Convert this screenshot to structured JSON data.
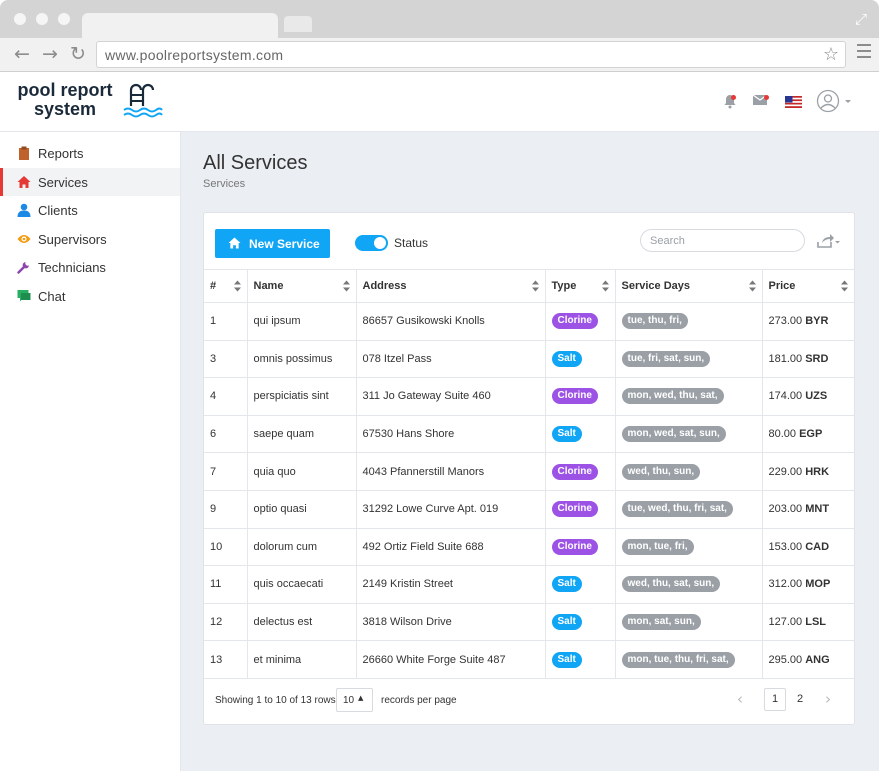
{
  "browser": {
    "url": "www.poolreportsystem.com"
  },
  "app": {
    "logo_line1": "pool report",
    "logo_line2": "system"
  },
  "sidebar": {
    "items": [
      {
        "label": "Reports",
        "icon": "clipboard-icon",
        "color": "#c0622b"
      },
      {
        "label": "Services",
        "icon": "home-icon",
        "color": "#e53935",
        "active": true
      },
      {
        "label": "Clients",
        "icon": "user-icon",
        "color": "#1e88e5"
      },
      {
        "label": "Supervisors",
        "icon": "eye-icon",
        "color": "#f39c12"
      },
      {
        "label": "Technicians",
        "icon": "wrench-icon",
        "color": "#8e44ad"
      },
      {
        "label": "Chat",
        "icon": "chat-icon",
        "color": "#27ae60"
      }
    ]
  },
  "page": {
    "title": "All Services",
    "breadcrumb": "Services"
  },
  "toolbar": {
    "new_label": "New Service",
    "status_label": "Status",
    "status_on": true,
    "search_placeholder": "Search"
  },
  "table": {
    "columns": [
      "#",
      "Name",
      "Address",
      "Type",
      "Service Days",
      "Price"
    ],
    "rows": [
      {
        "id": "1",
        "name": "qui ipsum",
        "address": "86657 Gusikowski Knolls",
        "type": "Clorine",
        "days": "tue, thu, fri,",
        "price": "273.00",
        "currency": "BYR"
      },
      {
        "id": "3",
        "name": "omnis possimus",
        "address": "078 Itzel Pass",
        "type": "Salt",
        "days": "tue, fri, sat, sun,",
        "price": "181.00",
        "currency": "SRD"
      },
      {
        "id": "4",
        "name": "perspiciatis sint",
        "address": "311 Jo Gateway Suite 460",
        "type": "Clorine",
        "days": "mon, wed, thu, sat,",
        "price": "174.00",
        "currency": "UZS"
      },
      {
        "id": "6",
        "name": "saepe quam",
        "address": "67530 Hans Shore",
        "type": "Salt",
        "days": "mon, wed, sat, sun,",
        "price": "80.00",
        "currency": "EGP"
      },
      {
        "id": "7",
        "name": "quia quo",
        "address": "4043 Pfannerstill Manors",
        "type": "Clorine",
        "days": "wed, thu, sun,",
        "price": "229.00",
        "currency": "HRK"
      },
      {
        "id": "9",
        "name": "optio quasi",
        "address": "31292 Lowe Curve Apt. 019",
        "type": "Clorine",
        "days": "tue, wed, thu, fri, sat,",
        "price": "203.00",
        "currency": "MNT"
      },
      {
        "id": "10",
        "name": "dolorum cum",
        "address": "492 Ortiz Field Suite 688",
        "type": "Clorine",
        "days": "mon, tue, fri,",
        "price": "153.00",
        "currency": "CAD"
      },
      {
        "id": "11",
        "name": "quis occaecati",
        "address": "2149 Kristin Street",
        "type": "Salt",
        "days": "wed, thu, sat, sun,",
        "price": "312.00",
        "currency": "MOP"
      },
      {
        "id": "12",
        "name": "delectus est",
        "address": "3818 Wilson Drive",
        "type": "Salt",
        "days": "mon, sat, sun,",
        "price": "127.00",
        "currency": "LSL"
      },
      {
        "id": "13",
        "name": "et minima",
        "address": "26660 White Forge Suite 487",
        "type": "Salt",
        "days": "mon, tue, thu, fri, sat,",
        "price": "295.00",
        "currency": "ANG"
      }
    ]
  },
  "pagination": {
    "info": "Showing 1 to 10 of 13 rows",
    "per_page": "10",
    "per_page_label": "records per page",
    "pages": [
      "1",
      "2"
    ],
    "current": "1"
  },
  "colors": {
    "accent": "#10a5f5",
    "clorine": "#9d52e6",
    "salt": "#10a5f5",
    "days": "#9aa0a6"
  }
}
